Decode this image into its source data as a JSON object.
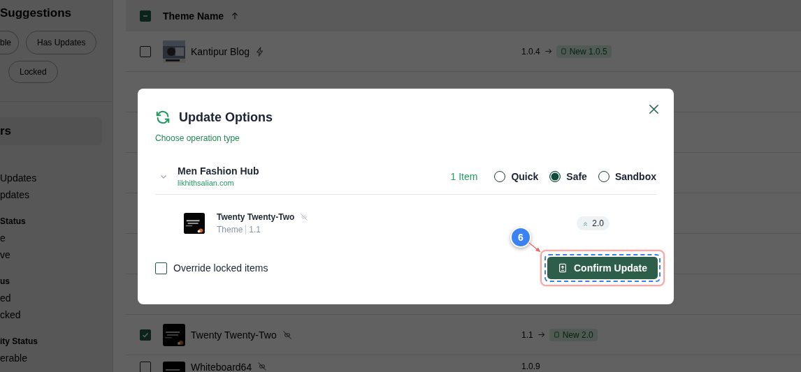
{
  "sidebar": {
    "heading": "Suggestions",
    "chips": [
      {
        "label": "ble"
      },
      {
        "label": "Has Updates"
      },
      {
        "label": "Locked"
      }
    ],
    "filters_heading": "rs",
    "groups": [
      {
        "items": [
          "Updates",
          "pdates"
        ]
      },
      {
        "title": "Status",
        "items": [
          "e",
          "ve"
        ]
      },
      {
        "title": "us",
        "items": [
          "ed",
          "cked"
        ]
      },
      {
        "title": "ity Status",
        "items": [
          "erable"
        ]
      }
    ]
  },
  "table": {
    "header_checkbox": {
      "indeterminate": true
    },
    "columns": [
      {
        "label": "Theme Name",
        "sorted": true
      }
    ],
    "rows": [
      {
        "name": "Kantipur Blog",
        "selected": false,
        "kind": "bolt",
        "current": "1.0.4",
        "new": "New 1.0.5"
      },
      {
        "name": "Twenty Twenty-Two",
        "selected": true,
        "kind": "unlink",
        "current": "1.1",
        "new": "New 2.0"
      },
      {
        "name": "Whiteboard64",
        "selected": false,
        "kind": "unlink",
        "current": "1.0.9"
      }
    ]
  },
  "dialog": {
    "title": "Update Options",
    "subtitle": "Choose operation type",
    "site": {
      "name": "Men Fashion Hub",
      "url": "likhithsalian.com",
      "count": "1 Item",
      "expanded": true
    },
    "modes": [
      {
        "label": "Quick",
        "selected": false
      },
      {
        "label": "Safe",
        "selected": true
      },
      {
        "label": "Sandbox",
        "selected": false
      }
    ],
    "items": [
      {
        "name": "Twenty Twenty-Two",
        "kind": "unlink",
        "type": "Theme",
        "version": "1.1",
        "target": "2.0"
      }
    ],
    "override": {
      "label": "Override locked items",
      "checked": false
    },
    "confirm_button": "Confirm Update"
  },
  "annotation": {
    "label": "6"
  }
}
